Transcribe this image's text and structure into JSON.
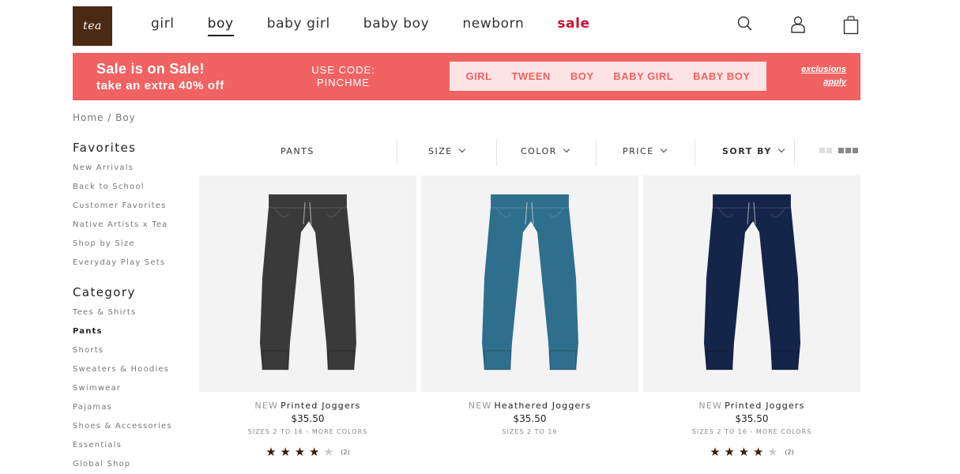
{
  "header": {
    "logo_text": "tea",
    "nav": [
      "girl",
      "boy",
      "baby girl",
      "baby boy",
      "newborn",
      "sale"
    ],
    "active_nav": "boy",
    "icons": [
      "search-icon",
      "account-icon",
      "bag-icon"
    ]
  },
  "promo": {
    "title": "Sale is on Sale!",
    "subtitle": "take an extra 40% off",
    "code_label": "USE CODE:",
    "code": "PINCHME",
    "links": [
      "GIRL",
      "TWEEN",
      "BOY",
      "BABY GIRL",
      "BABY BOY"
    ],
    "exclusions_line1": "exclusions",
    "exclusions_line2": "apply",
    "color": "#f16262"
  },
  "breadcrumb": "Home / Boy",
  "sidebar": {
    "favorites_heading": "Favorites",
    "favorites": [
      "New Arrivals",
      "Back to School",
      "Customer Favorites",
      "Native Artists x Tea",
      "Shop by Size",
      "Everyday Play Sets"
    ],
    "category_heading": "Category",
    "categories": [
      "Tees & Shirts",
      "Pants",
      "Shorts",
      "Sweaters & Hoodies",
      "Swimwear",
      "Pajamas",
      "Shoes & Accessories",
      "Essentials",
      "Global Shop"
    ],
    "current_category": "Pants"
  },
  "filters": {
    "title": "PANTS",
    "size": "SIZE",
    "color": "COLOR",
    "price": "PRICE",
    "sort": "SORT BY"
  },
  "products": [
    {
      "badge": "NEW",
      "name": "Printed Joggers",
      "price": "$35.50",
      "sizes": "SIZES 2 TO 16 - MORE COLORS",
      "rating": 4,
      "reviews": "(2)",
      "color": "#3a3a3a"
    },
    {
      "badge": "NEW",
      "name": "Heathered Joggers",
      "price": "$35.50",
      "sizes": "SIZES 2 TO 16",
      "rating": null,
      "reviews": "",
      "color": "#2f6f8e"
    },
    {
      "badge": "NEW",
      "name": "Printed Joggers",
      "price": "$35.50",
      "sizes": "SIZES 2 TO 16 - MORE COLORS",
      "rating": 4,
      "reviews": "(2)",
      "color": "#14254a"
    }
  ]
}
